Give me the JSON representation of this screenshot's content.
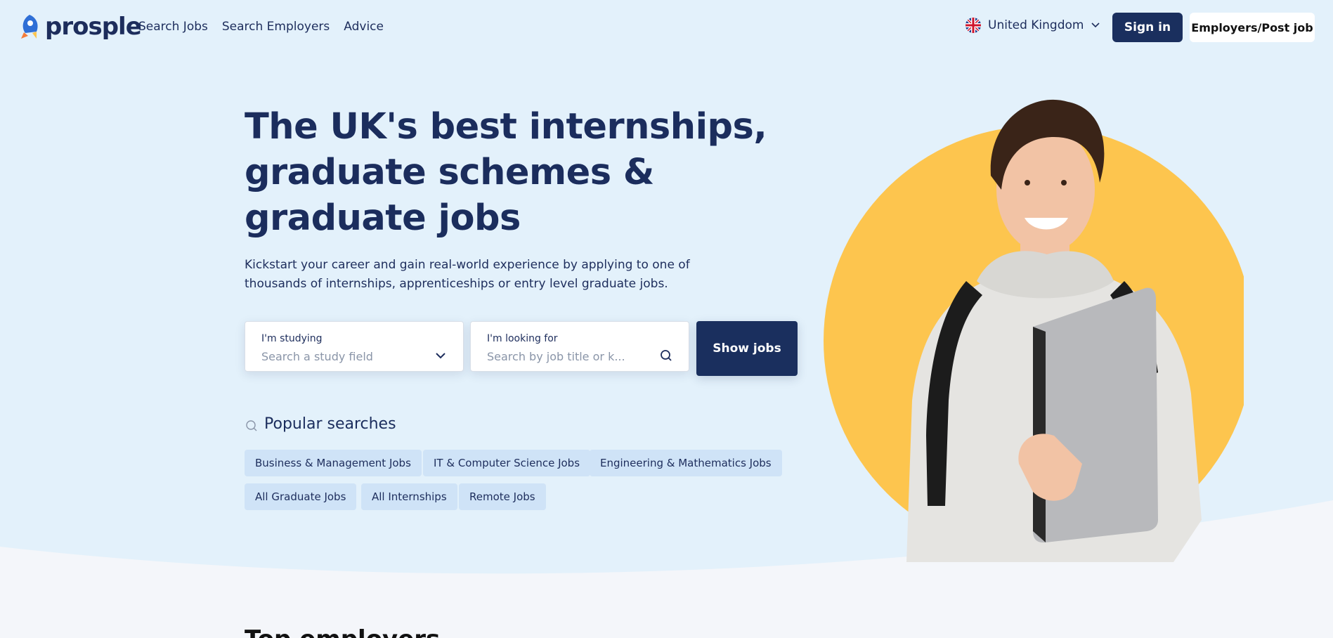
{
  "brand": {
    "name": "prosple",
    "accent": "#1a2f5e",
    "highlight": "#fdc54e",
    "hero_bg": "#e3f1fb"
  },
  "nav": {
    "items": [
      {
        "label": "Search Jobs"
      },
      {
        "label": "Search Employers"
      },
      {
        "label": "Advice"
      }
    ]
  },
  "header": {
    "country": "United Kingdom",
    "country_flag": "uk-flag-icon",
    "signin_label": "Sign in",
    "employers_label": "Employers/Post job"
  },
  "hero": {
    "headline": "The UK's best internships, graduate schemes & graduate jobs",
    "subtext": "Kickstart your career and gain real-world experience by applying to one of thousands of internships, apprenticeships or entry level graduate jobs."
  },
  "search": {
    "study": {
      "label": "I'm studying",
      "placeholder": "Search a study field"
    },
    "looking": {
      "label": "I'm looking for",
      "placeholder": "Search by job title or k..."
    },
    "submit_label": "Show jobs"
  },
  "popular": {
    "title": "Popular searches",
    "items": [
      "Business & Management Jobs",
      "IT & Computer Science Jobs",
      "Engineering & Mathematics Jobs",
      "All Graduate Jobs",
      "All Internships",
      "Remote Jobs"
    ]
  },
  "next_section": {
    "title": "Top employers"
  }
}
